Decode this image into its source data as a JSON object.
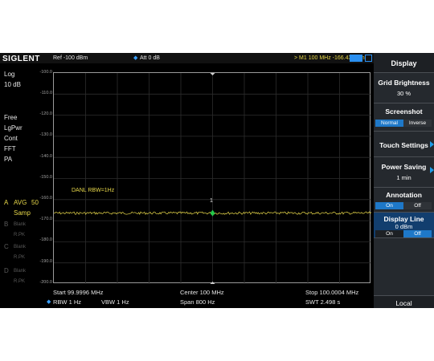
{
  "brand": "SIGLENT",
  "top": {
    "ref": "Ref  -100 dBm",
    "att": "Att  0 dB",
    "marker": ">  M1    100 MHz   -166.43 dBm"
  },
  "left_panel": {
    "scale_type": "Log",
    "scale_div": "10 dB",
    "items": [
      "Free",
      "LgPwr",
      "Cont",
      "FFT",
      "PA"
    ],
    "trace_a_label": "A",
    "trace_a_mode": "AVG",
    "trace_a_count": "50",
    "trace_a_type": "Samp",
    "trace_b_label": "B",
    "trace_b_mode": "Blank",
    "trace_b_type": "R.PK",
    "trace_c_label": "C",
    "trace_c_mode": "Blank",
    "trace_c_type": "R.PK",
    "trace_d_label": "D",
    "trace_d_mode": "Blank",
    "trace_d_type": "R.PK"
  },
  "y_ticks": [
    "-100.0",
    "-110.0",
    "-120.0",
    "-130.0",
    "-140.0",
    "-150.0",
    "-160.0",
    "-170.0",
    "-180.0",
    "-190.0",
    "-200.0"
  ],
  "annotation": "DANL RBW=1Hz",
  "marker_label": "1",
  "trace": {
    "level_dbm": -166.4,
    "ref_dbm": -100,
    "bottom_dbm": -200,
    "color": "#e8d84a"
  },
  "bottom": {
    "start": "Start  99.9996 MHz",
    "center": "Center  100 MHz",
    "stop": "Stop  100.0004 MHz",
    "rbw": "RBW 1 Hz",
    "vbw": "VBW  1 Hz",
    "span": "Span    800 Hz",
    "swt": "SWT  2.498 s"
  },
  "menu": {
    "title": "Display",
    "grid_brightness": {
      "label": "Grid Brightness",
      "value": "30 %"
    },
    "screenshot": {
      "label": "Screenshot",
      "opt1": "Normal",
      "opt2": "Inverse"
    },
    "touch_settings": "Touch Settings",
    "power_saving": {
      "label": "Power Saving",
      "value": "1 min"
    },
    "annotation": {
      "label": "Annotation",
      "opt1": "On",
      "opt2": "Off"
    },
    "display_line": {
      "label": "Display Line",
      "value": "0 dBm",
      "opt1": "On",
      "opt2": "Off"
    },
    "local": "Local"
  },
  "colors": {
    "accent": "#1e78c8",
    "trace": "#e8d84a",
    "marker": "#22c84a"
  }
}
